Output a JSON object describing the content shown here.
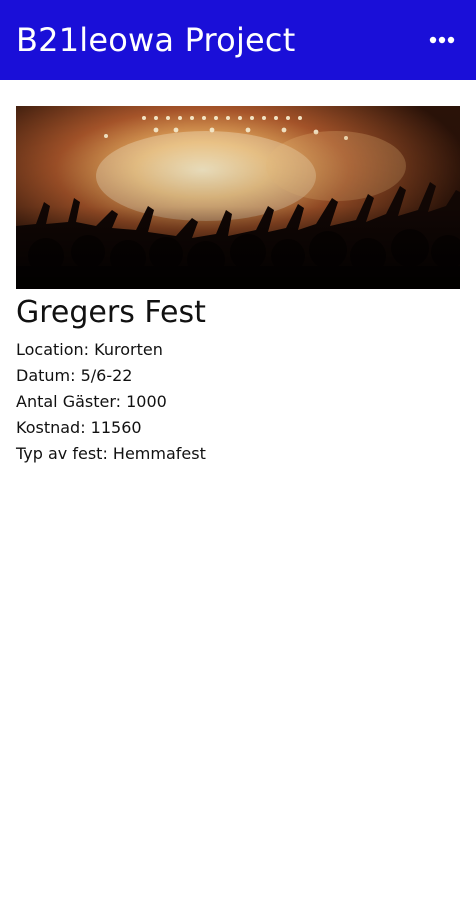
{
  "app_bar": {
    "title": "B21leowa Project",
    "background": "#1a0fd8",
    "menu_icon": "more-horizontal-icon"
  },
  "event": {
    "image_description_icon": "concert-crowd-image",
    "title": "Gregers Fest",
    "details": [
      {
        "label": "Location",
        "value": "Kurorten",
        "text": "Location: Kurorten"
      },
      {
        "label": "Datum",
        "value": "5/6-22",
        "text": "Datum: 5/6-22"
      },
      {
        "label": "Antal Gäster",
        "value": "1000",
        "text": "Antal Gäster: 1000"
      },
      {
        "label": "Kostnad",
        "value": "11560",
        "text": "Kostnad: 11560"
      },
      {
        "label": "Typ av fest",
        "value": "Hemmafest",
        "text": "Typ av fest: Hemmafest"
      }
    ]
  }
}
